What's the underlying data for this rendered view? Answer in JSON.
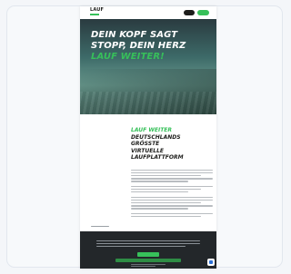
{
  "header": {
    "logo_text": "LAUF",
    "login_label": "",
    "cta_label": ""
  },
  "hero": {
    "line1": "DEIN KOPF SAGT",
    "line2": "STOPP, DEIN HERZ",
    "line3": "LAUF WEITER!"
  },
  "intro": {
    "side_label": "",
    "heading_line1": "LAUF WEITER",
    "heading_line2": "DEUTSCHLANDS",
    "heading_line3": "GRÖSSTE",
    "heading_line4": "VIRTUELLE",
    "heading_line5": "LAUFPLATTFORM"
  },
  "consent": {
    "accept_label": "",
    "reject_label": ""
  },
  "colors": {
    "accent_green": "#37c05a",
    "dark": "#1d1d1b",
    "banner_bg": "#23272a"
  },
  "icons": {
    "chat": "chat-icon"
  }
}
